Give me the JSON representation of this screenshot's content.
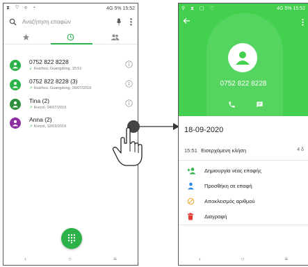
{
  "left_screen": {
    "statusbar": {
      "left_icons": "⧗ ♡ ⚲ ◔",
      "right_text": "4G 5% 15:52"
    },
    "search": {
      "placeholder": "Αναζήτηση επαφών"
    },
    "tabs": [
      {
        "icon": "star-icon"
      },
      {
        "icon": "clock-icon",
        "active": true
      },
      {
        "icon": "contacts-icon"
      }
    ],
    "calls": [
      {
        "name": "0752 822 8228",
        "sub": "Huizhou, Guangdong, 15:51",
        "avatar_color": "#2bb34a",
        "direction": "missed"
      },
      {
        "name": "0752 822 8228 (3)",
        "sub": "Huizhou, Guangdong, 05/07/2019",
        "avatar_color": "#2bb34a",
        "direction": "outgoing"
      },
      {
        "name": "Tina (2)",
        "sub": "Κινητό, 04/07/2019",
        "avatar_color": "#2f8f3e",
        "direction": "outgoing"
      },
      {
        "name": "Anna (2)",
        "sub": "Κινητό, 12/03/2019",
        "avatar_color": "#8e2ea3",
        "direction": "outgoing"
      }
    ],
    "navbar": [
      "‹",
      "○",
      "≡"
    ]
  },
  "right_screen": {
    "statusbar": {
      "left_icons": "⚲ ⧗ ▢ ♡",
      "right_text": "4G 5% 15:52"
    },
    "contact_number": "0752 822 8228",
    "date_title": "18-09-2020",
    "call": {
      "time": "15:51",
      "type": "Εισερχόμενη κλήση",
      "duration": "4 δ"
    },
    "actions": [
      {
        "label": "Δημιουργία νέας επαφής",
        "icon": "add-contact-icon",
        "color": "#2bb34a"
      },
      {
        "label": "Προσθήκη σε επαφή",
        "icon": "person-icon",
        "color": "#1e88e5"
      },
      {
        "label": "Αποκλεισμός αριθμού",
        "icon": "block-icon",
        "color": "#f4a62a"
      },
      {
        "label": "Διαγραφή",
        "icon": "trash-icon",
        "color": "#e53935"
      }
    ],
    "navbar": [
      "‹",
      "○",
      "≡"
    ]
  },
  "colors": {
    "accent": "#2bb34a",
    "header_green": "#43d04f"
  }
}
